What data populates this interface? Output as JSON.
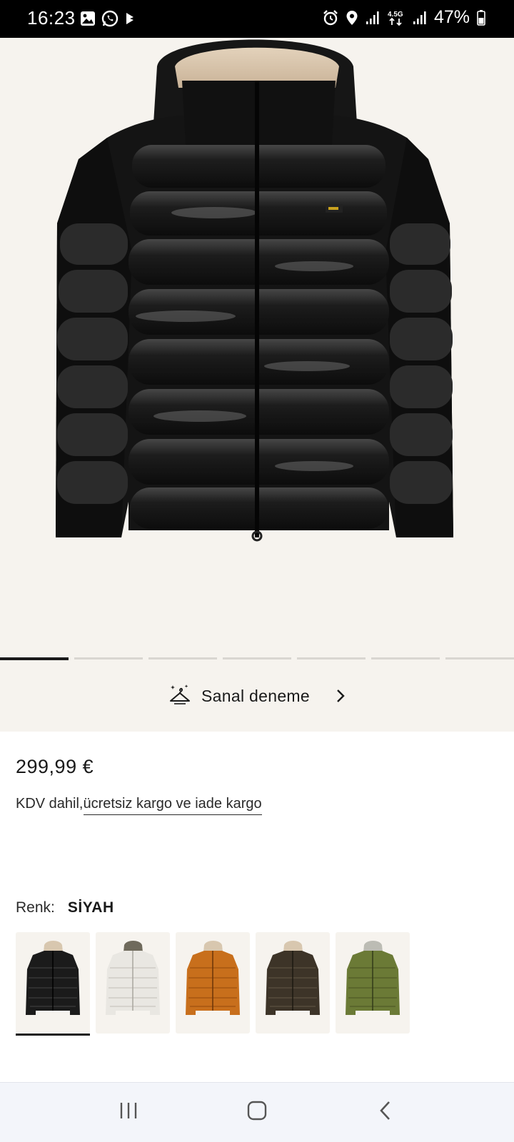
{
  "status_bar": {
    "time": "16:23",
    "left_icons": [
      "gallery-icon",
      "whatsapp-icon",
      "play-icon"
    ],
    "right_icons": [
      "alarm-icon",
      "location-icon",
      "signal-icon",
      "network-4.5g-icon",
      "signal-icon-2",
      "battery-icon"
    ],
    "network_label": "4.5G",
    "battery": "47%"
  },
  "carousel": {
    "total": 7,
    "active_index": 0
  },
  "tryon": {
    "label": "Sanal deneme",
    "icon": "hanger-sparkle-icon"
  },
  "product": {
    "price": "299,99 €",
    "tax_prefix": "KDV dahil,",
    "tax_link": "ücretsiz kargo ve iade kargo"
  },
  "color": {
    "label": "Renk:",
    "value": "SİYAH",
    "swatches": [
      {
        "name": "black",
        "hex": "#1b1b1b",
        "selected": true
      },
      {
        "name": "white",
        "hex": "#e9e7e2",
        "selected": false
      },
      {
        "name": "orange",
        "hex": "#c86f1c",
        "selected": false
      },
      {
        "name": "brown",
        "hex": "#3d3428",
        "selected": false
      },
      {
        "name": "olive",
        "hex": "#6b7a36",
        "selected": false
      }
    ]
  },
  "navbar": {
    "icons": [
      "recent-apps-icon",
      "home-icon",
      "back-icon"
    ]
  },
  "colors": {
    "background": "#ffffff",
    "hero_background": "#f6f3ee",
    "text": "#1a1a1a",
    "navbar": "#f3f5fa"
  }
}
